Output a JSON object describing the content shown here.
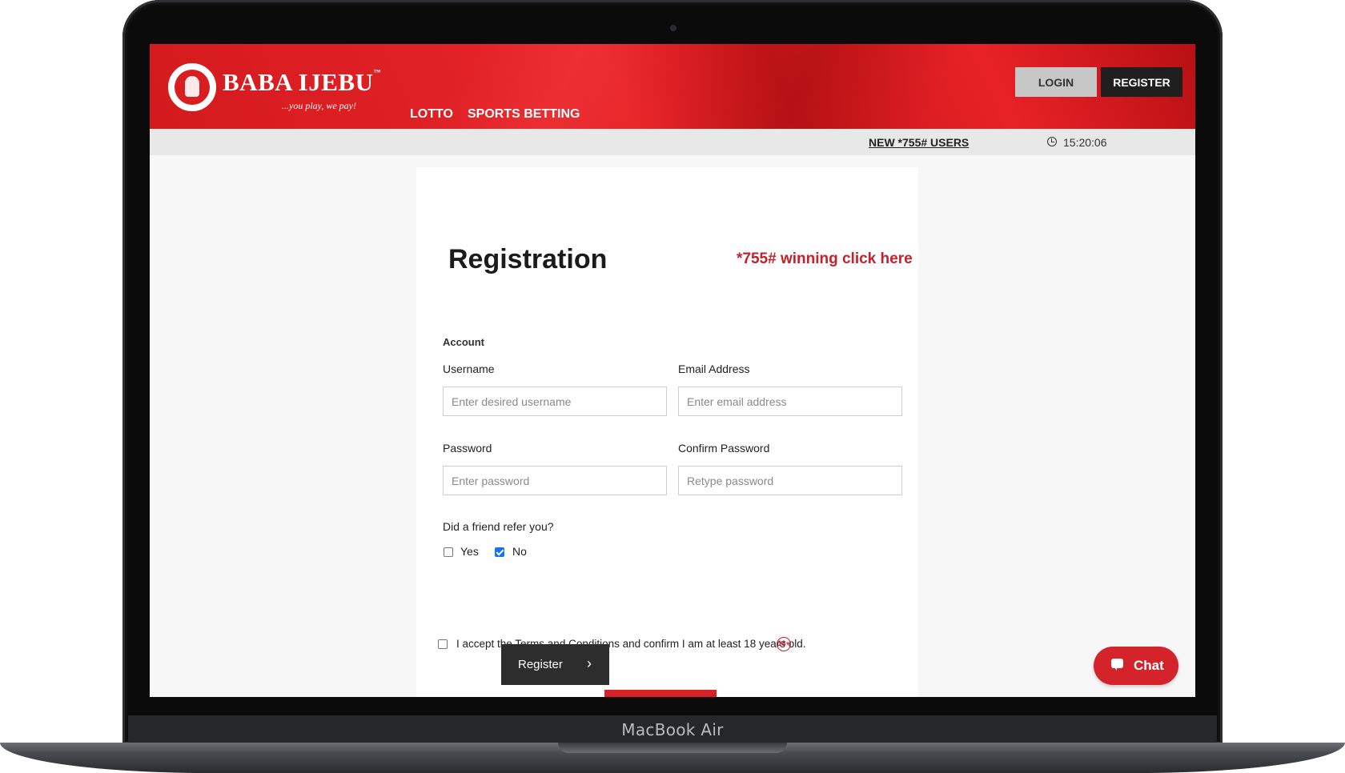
{
  "device": {
    "brand_label": "MacBook Air"
  },
  "header": {
    "logo_text": "BABA IJEBU",
    "logo_trademark": "™",
    "tagline": "...you play, we pay!",
    "nav": [
      {
        "label": "LOTTO"
      },
      {
        "label": "SPORTS BETTING"
      }
    ],
    "login_label": "LOGIN",
    "register_label": "REGISTER"
  },
  "subbar": {
    "promo_link": "NEW *755# USERS",
    "clock": "15:20:06"
  },
  "form": {
    "title": "Registration",
    "promo_link": "*755# winning click here",
    "section_label": "Account",
    "username": {
      "label": "Username",
      "placeholder": "Enter desired username",
      "value": ""
    },
    "email": {
      "label": "Email Address",
      "placeholder": "Enter email address",
      "value": ""
    },
    "password": {
      "label": "Password",
      "placeholder": "Enter password",
      "value": ""
    },
    "confirm_password": {
      "label": "Confirm Password",
      "placeholder": "Retype password",
      "value": ""
    },
    "referral": {
      "question": "Did a friend refer you?",
      "options": [
        {
          "label": "Yes",
          "checked": false
        },
        {
          "label": "No",
          "checked": true
        }
      ]
    },
    "terms": {
      "label": "I accept the Terms and Conditions and confirm I am at least 18 years old.",
      "checked": false,
      "age_badge": "18+"
    },
    "submit_label": "Register"
  },
  "chat": {
    "label": "Chat"
  },
  "colors": {
    "brand_red": "#d91e22",
    "promo_red": "#c8202a",
    "checkbox_blue": "#1a73e8"
  }
}
